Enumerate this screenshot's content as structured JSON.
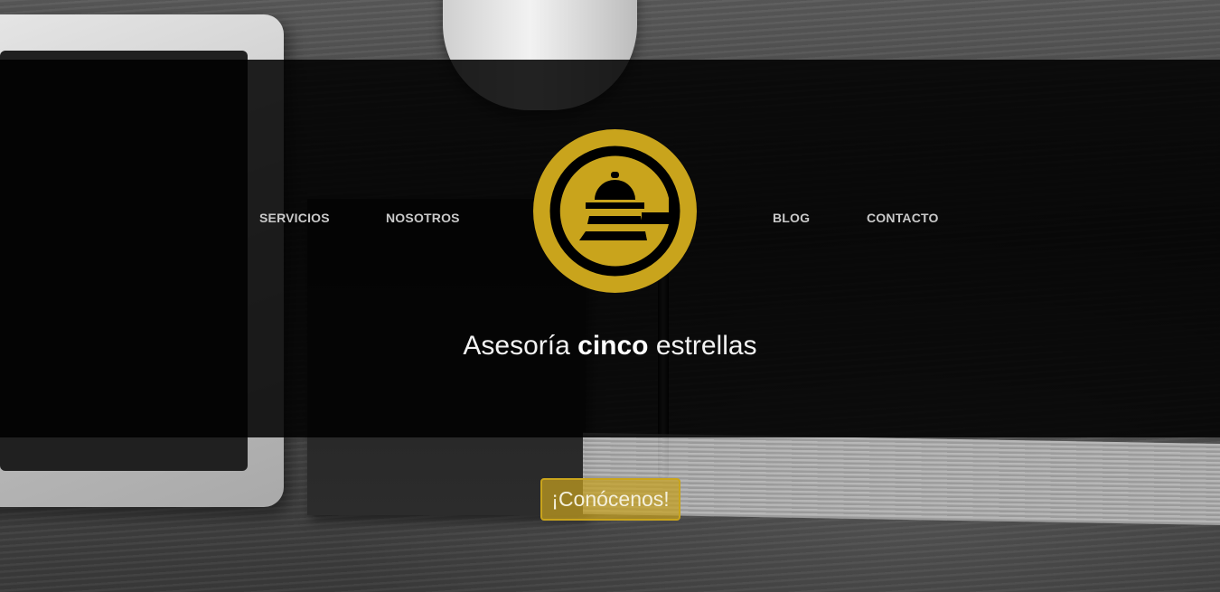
{
  "nav": {
    "items": [
      {
        "label": "SERVICIOS"
      },
      {
        "label": "NOSOTROS"
      },
      {
        "label": "BLOG"
      },
      {
        "label": "CONTACTO"
      }
    ]
  },
  "logo": {
    "icon": "service-bell-logo-icon",
    "color": "#C9A41C"
  },
  "hero": {
    "tagline_pre": "Asesoría ",
    "tagline_bold": "cinco",
    "tagline_post": " estrellas",
    "cta_label": "¡Conócenos!"
  },
  "colors": {
    "accent": "#C9A41C",
    "overlay": "#000000",
    "nav_text": "#C9C9C9"
  }
}
